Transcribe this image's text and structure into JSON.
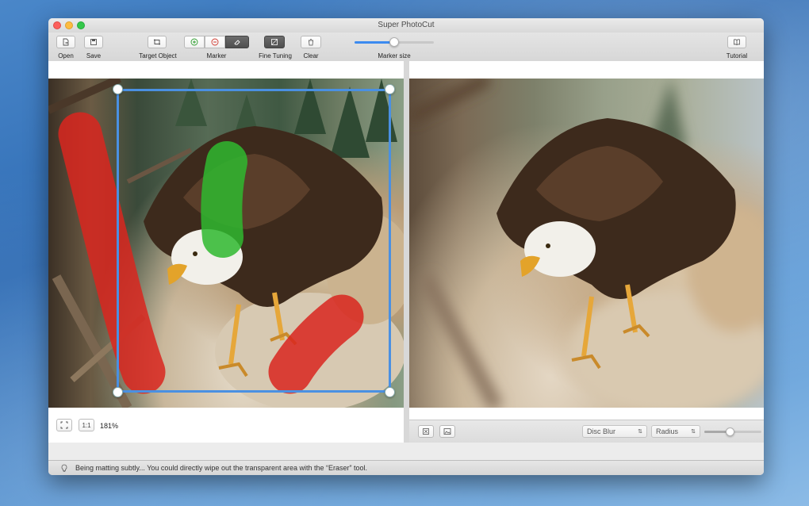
{
  "window": {
    "title": "Super PhotoCut"
  },
  "toolbar": {
    "open_label": "Open",
    "save_label": "Save",
    "target_label": "Target Object",
    "marker_label": "Marker",
    "fine_tuning_label": "Fine Tuning",
    "clear_label": "Clear",
    "marker_size_label": "Marker size",
    "marker_size_value": 0.5,
    "tutorial_label": "Tutorial"
  },
  "left_panel": {
    "fit_icon": "fit-screen-icon",
    "actual_size_label": "1:1",
    "zoom": "181%"
  },
  "right_panel": {
    "blur_type": "Disc Blur",
    "radius_label": "Radius",
    "radius_value": 0.45
  },
  "status": {
    "message": "Being matting subtly... You could directly wipe out the transparent area with the “Eraser” tool."
  },
  "colors": {
    "accent": "#4a90e2",
    "marker_foreground": "#2fb82f",
    "marker_background": "#d9261f"
  }
}
